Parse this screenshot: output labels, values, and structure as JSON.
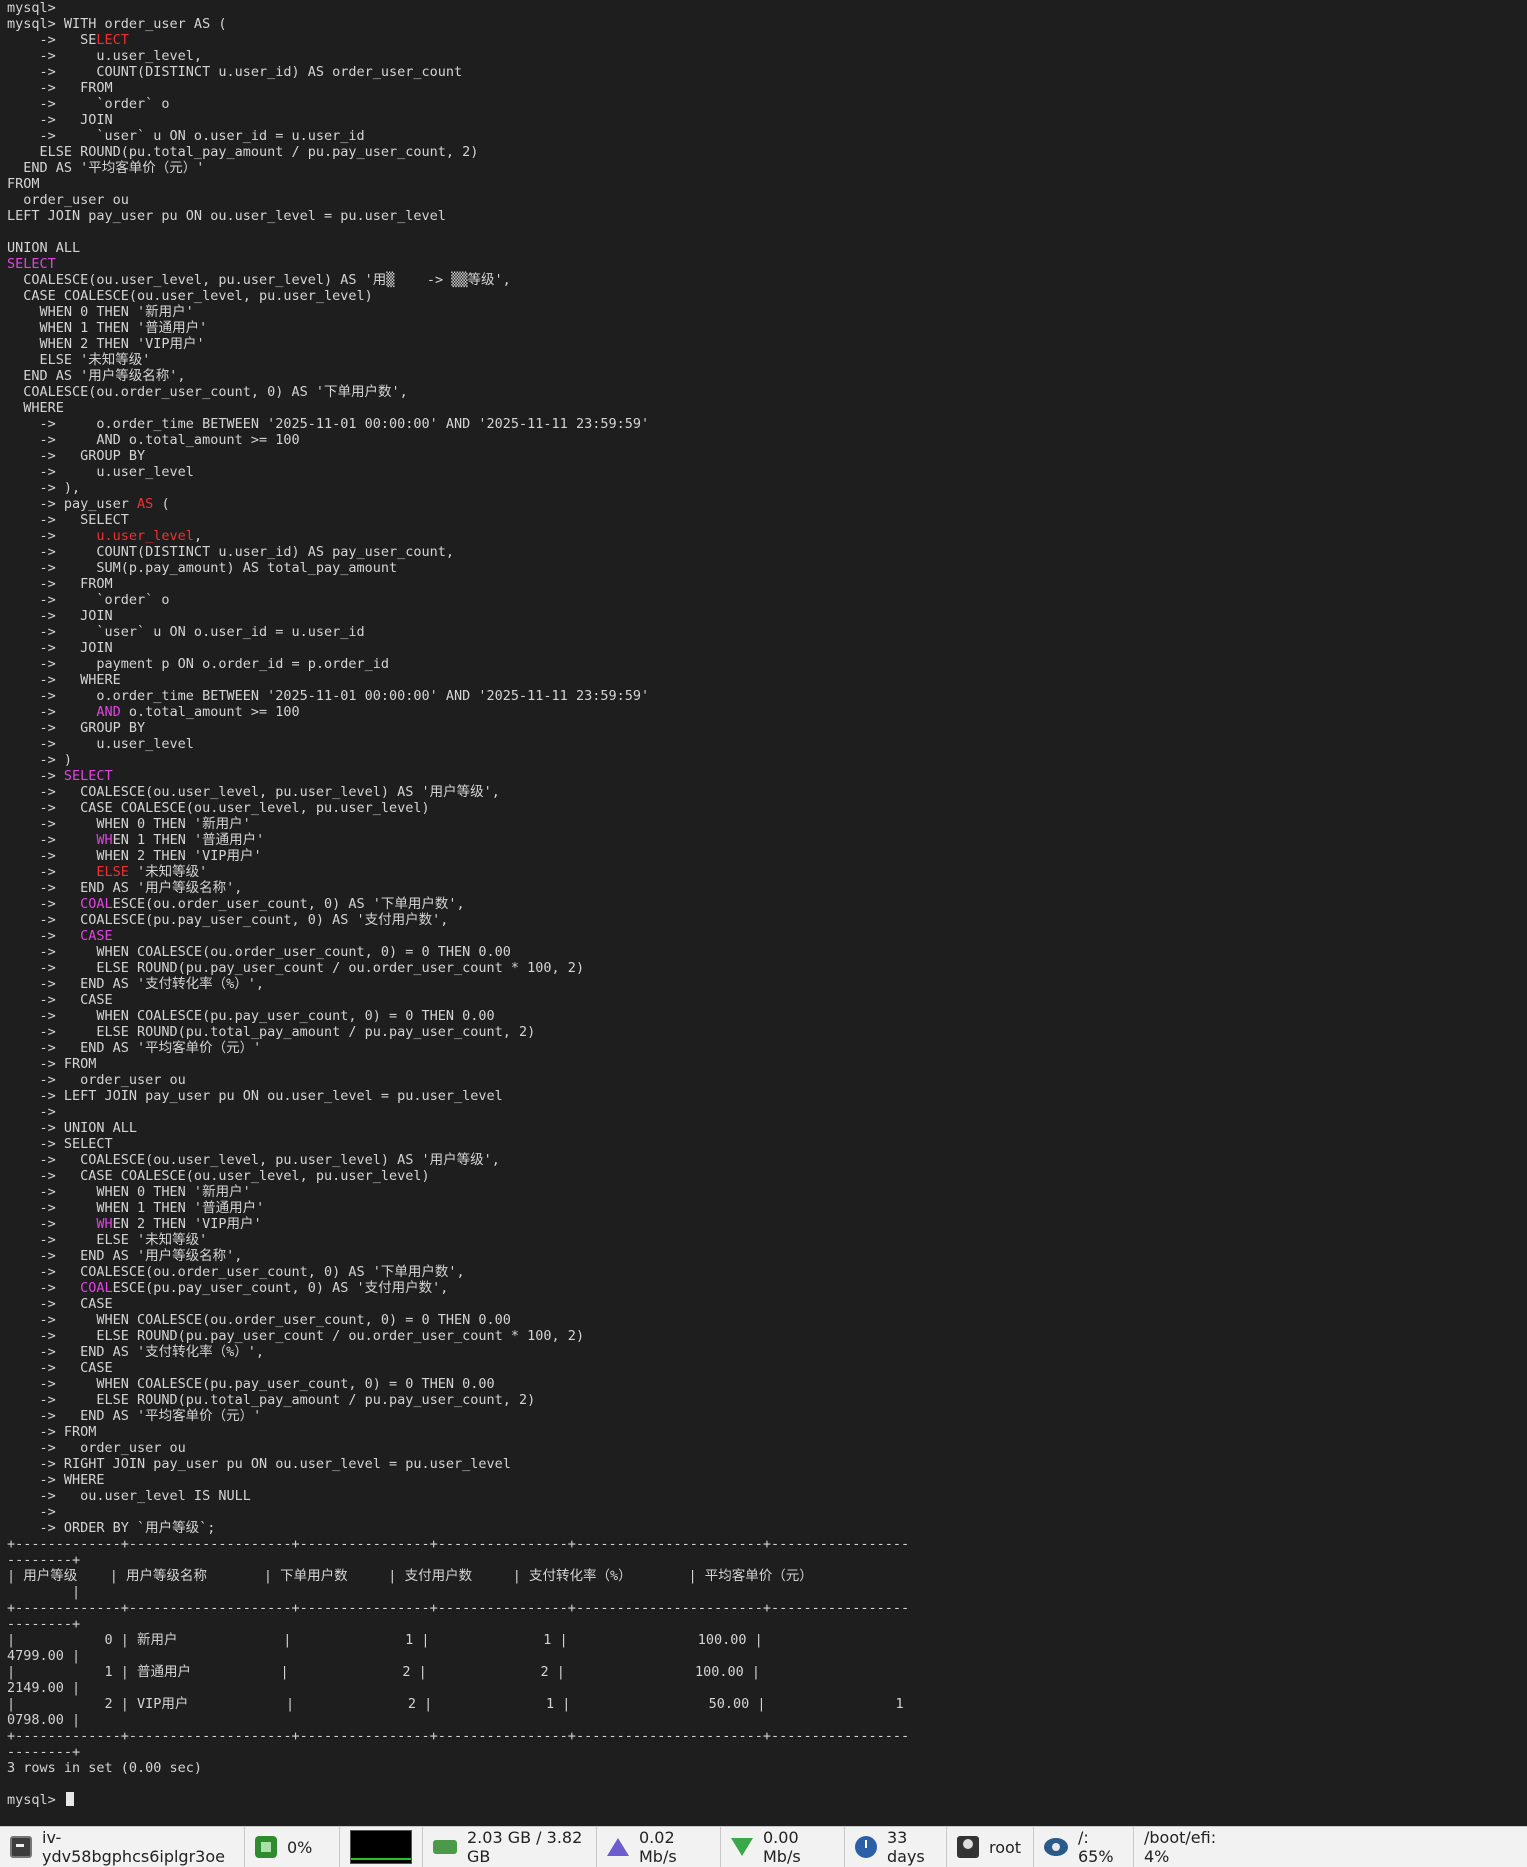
{
  "terminal": {
    "lines": [
      "mysql>",
      "mysql> WITH order_user AS (",
      "    ->   SE@@LECT",
      "    ->     u.user_level,",
      "    ->     COUNT(DISTINCT u.user_id) AS order_user_count",
      "    ->   FROM",
      "    ->     `order` o",
      "    ->   JOIN",
      "    ->     `user` u ON o.user_id = u.user_id",
      "    ELSE ROUND(pu.total_pay_amount / pu.pay_user_count, 2)",
      "  END AS '平均客单价（元）'",
      "FROM",
      "  order_user ou",
      "LEFT JOIN pay_user pu ON ou.user_level = pu.user_level",
      "",
      "UNION ALL",
      "SELECT",
      "  COALESCE(ou.user_level, pu.user_level) AS '用▒    -> ▒▒等级',",
      "  CASE COALESCE(ou.user_level, pu.user_level)",
      "    WHEN 0 THEN '新用户'",
      "    WHEN 1 THEN '普通用户'",
      "    WHEN 2 THEN 'VIP用户'",
      "    ELSE '未知等级'",
      "  END AS '用户等级名称',",
      "  COALESCE(ou.order_user_count, 0) AS '下单用户数',",
      "  WHERE",
      "    ->     o.order_time BETWEEN '2025-11-01 00:00:00' AND '2025-11-11 23:59:59'",
      "    ->     AND o.total_amount >= 100",
      "    ->   GROUP BY",
      "    ->     u.user_level",
      "    -> ),",
      "    -> pay_user AS (",
      "    ->   SELECT",
      "    ->     u.user_level,",
      "    ->     COUNT(DISTINCT u.user_id) AS pay_user_count,",
      "    ->     SUM(p.pay_amount) AS total_pay_amount",
      "    ->   FROM",
      "    ->     `order` o",
      "    ->   JOIN",
      "    ->     `user` u ON o.user_id = u.user_id",
      "    ->   JOIN",
      "    ->     payment p ON o.order_id = p.order_id",
      "    ->   WHERE",
      "    ->     o.order_time BETWEEN '2025-11-01 00:00:00' AND '2025-11-11 23:59:59'",
      "    ->     AND o.total_amount >= 100",
      "    ->   GROUP BY",
      "    ->     u.user_level",
      "    -> )",
      "    -> SELECT",
      "    ->   COALESCE(ou.user_level, pu.user_level) AS '用户等级',",
      "    ->   CASE COALESCE(ou.user_level, pu.user_level)",
      "    ->     WHEN 0 THEN '新用户'",
      "    ->     WHEN 1 THEN '普通用户'",
      "    ->     WHEN 2 THEN 'VIP用户'",
      "    ->     ELSE '未知等级'",
      "    ->   END AS '用户等级名称',",
      "    ->   COALESCE(ou.order_user_count, 0) AS '下单用户数',",
      "    ->   COALESCE(pu.pay_user_count, 0) AS '支付用户数',",
      "    ->   CASE",
      "    ->     WHEN COALESCE(ou.order_user_count, 0) = 0 THEN 0.00",
      "    ->     ELSE ROUND(pu.pay_user_count / ou.order_user_count * 100, 2)",
      "    ->   END AS '支付转化率（%）',",
      "    ->   CASE",
      "    ->     WHEN COALESCE(pu.pay_user_count, 0) = 0 THEN 0.00",
      "    ->     ELSE ROUND(pu.total_pay_amount / pu.pay_user_count, 2)",
      "    ->   END AS '平均客单价（元）'",
      "    -> FROM",
      "    ->   order_user ou",
      "    -> LEFT JOIN pay_user pu ON ou.user_level = pu.user_level",
      "    ->",
      "    -> UNION ALL",
      "    -> SELECT",
      "    ->   COALESCE(ou.user_level, pu.user_level) AS '用户等级',",
      "    ->   CASE COALESCE(ou.user_level, pu.user_level)",
      "    ->     WHEN 0 THEN '新用户'",
      "    ->     WHEN 1 THEN '普通用户'",
      "    ->     WHEN 2 THEN 'VIP用户'",
      "    ->     ELSE '未知等级'",
      "    ->   END AS '用户等级名称',",
      "    ->   COALESCE(ou.order_user_count, 0) AS '下单用户数',",
      "    ->   COALESCE(pu.pay_user_count, 0) AS '支付用户数',",
      "    ->   CASE",
      "    ->     WHEN COALESCE(ou.order_user_count, 0) = 0 THEN 0.00",
      "    ->     ELSE ROUND(pu.pay_user_count / ou.order_user_count * 100, 2)",
      "    ->   END AS '支付转化率（%）',",
      "    ->   CASE",
      "    ->     WHEN COALESCE(pu.pay_user_count, 0) = 0 THEN 0.00",
      "    ->     ELSE ROUND(pu.total_pay_amount / pu.pay_user_count, 2)",
      "    ->   END AS '平均客单价（元）'",
      "    -> FROM",
      "    ->   order_user ou",
      "    -> RIGHT JOIN pay_user pu ON ou.user_level = pu.user_level",
      "    -> WHERE",
      "    ->   ou.user_level IS NULL",
      "    ->",
      "    -> ORDER BY `用户等级`;",
      "+-------------+--------------------+----------------+----------------+-----------------------+-----------------",
      "--------+",
      "| 用户等级    | 用户等级名称       | 下单用户数     | 支付用户数     | 支付转化率（%）       | 平均客单价（元）",
      "        |",
      "+-------------+--------------------+----------------+----------------+-----------------------+-----------------",
      "--------+",
      "|           0 | 新用户             |              1 |              1 |                100.00 |",
      "4799.00 |",
      "|           1 | 普通用户           |              2 |              2 |                100.00 |",
      "2149.00 |",
      "|           2 | VIP用户            |              2 |              1 |                 50.00 |                1",
      "0798.00 |",
      "+-------------+--------------------+----------------+----------------+-----------------------+-----------------",
      "--------+",
      "3 rows in set (0.00 sec)",
      "",
      "mysql> "
    ]
  },
  "statusbar": {
    "hostname": "iv-ydv58bgphcs6iplgr3oe",
    "cpu": "0%",
    "memory": "2.03 GB / 3.82 GB",
    "upload": "0.02 Mb/s",
    "download": "0.00 Mb/s",
    "uptime": "33 days",
    "user": "root",
    "disk_root": "/: 65%",
    "disk_boot": "/boot/efi: 4%"
  }
}
